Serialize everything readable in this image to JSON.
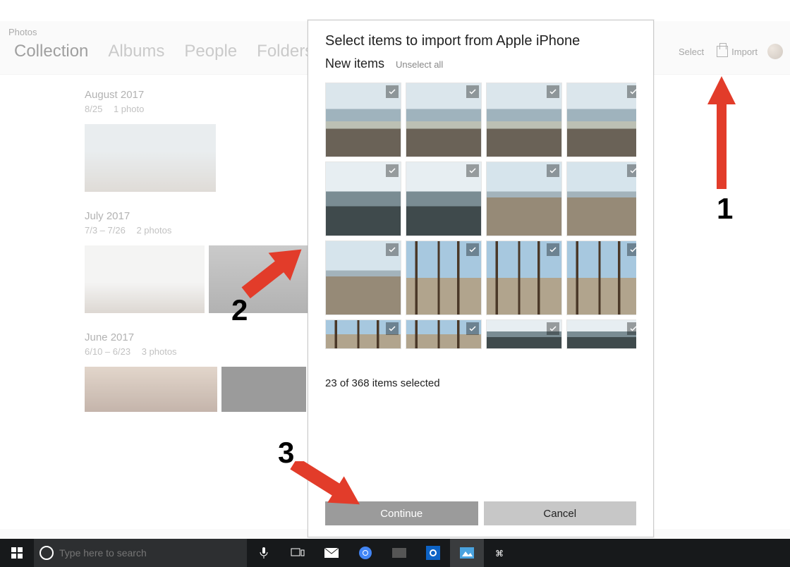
{
  "app": {
    "title": "Photos"
  },
  "tabs": {
    "collection": "Collection",
    "albums": "Albums",
    "people": "People",
    "folders": "Folders"
  },
  "toolbar": {
    "select": "Select",
    "import": "Import"
  },
  "collection": [
    {
      "month": "August 2017",
      "sub1": "8/25",
      "sub2": "1 photo"
    },
    {
      "month": "July 2017",
      "sub1": "7/3 – 7/26",
      "sub2": "2 photos"
    },
    {
      "month": "June 2017",
      "sub1": "6/10 – 6/23",
      "sub2": "3 photos"
    }
  ],
  "modal": {
    "title": "Select items to import from Apple iPhone",
    "subtitle": "New items",
    "unselect": "Unselect all",
    "selected_text": "23 of 368 items selected",
    "continue": "Continue",
    "cancel": "Cancel"
  },
  "taskbar": {
    "search_placeholder": "Type here to search"
  },
  "annotations": {
    "num1": "1",
    "num2": "2",
    "num3": "3"
  }
}
